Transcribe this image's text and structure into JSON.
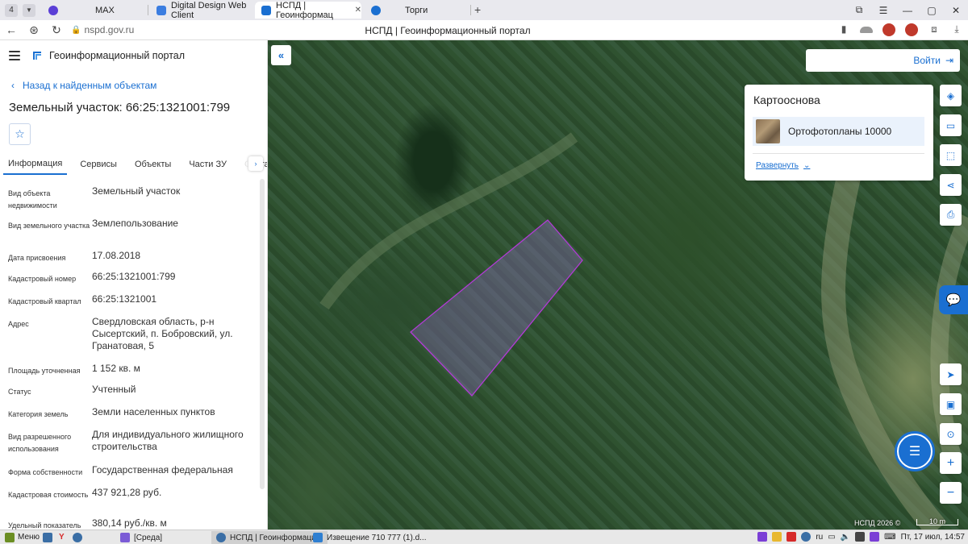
{
  "browser": {
    "tab_count": "4",
    "tabs": [
      {
        "title": "MAX",
        "color": "#5b3fd6"
      },
      {
        "title": "Digital Design Web Client",
        "color": "#3b7de0"
      },
      {
        "title": "НСПД | Геоинформац",
        "color": "#1a6fd1",
        "active": true
      },
      {
        "title": "Торги",
        "color": "#1a6fd1"
      }
    ],
    "url": "nspd.gov.ru",
    "page_title": "НСПД | Геоинформационный портал"
  },
  "app": {
    "name": "Геоинформационный портал",
    "back_link": "Назад к найденным объектам",
    "object_title": "Земельный участок: 66:25:1321001:799",
    "tabs": [
      "Информация",
      "Сервисы",
      "Объекты",
      "Части ЗУ",
      "Состав"
    ],
    "properties": [
      {
        "label": "Вид объекта недвижимости",
        "value": "Земельный участок"
      },
      {
        "label": "Вид земельного участка",
        "value": "Землепользование"
      },
      {
        "label": "Дата присвоения",
        "value": "17.08.2018"
      },
      {
        "label": "Кадастровый номер",
        "value": "66:25:1321001:799"
      },
      {
        "label": "Кадастровый квартал",
        "value": "66:25:1321001"
      },
      {
        "label": "Адрес",
        "value": "Свердловская область, р-н Сысертский, п. Бобровский, ул. Гранатовая, 5"
      },
      {
        "label": "Площадь уточненная",
        "value": "1 152 кв. м"
      },
      {
        "label": "Статус",
        "value": "Учтенный"
      },
      {
        "label": "Категория земель",
        "value": "Земли населенных пунктов"
      },
      {
        "label": "Вид разрешенного использования",
        "value": "Для индивидуального жилищного строительства"
      },
      {
        "label": "Форма собственности",
        "value": "Государственная федеральная"
      },
      {
        "label": "Кадастровая стоимость",
        "value": "437 921,28 руб."
      },
      {
        "label": "Удельный показатель",
        "value": "380,14 руб./кв. м"
      }
    ]
  },
  "map": {
    "login_label": "Войти",
    "basemap_title": "Картооснова",
    "basemap_item": "Ортофотопланы 10000",
    "expand_label": "Развернуть",
    "copyright": "НСПД 2026 ©",
    "scale_label": "10 m",
    "parcel_color": "#b23ad6"
  },
  "taskbar": {
    "menu_label": "Меню",
    "tasks": [
      "[Среда]",
      "НСПД | Геоинформаци...",
      "Извещение 710 777 (1).d..."
    ],
    "lang": "ru",
    "clock": "Пт, 17 июл, 14:57"
  }
}
